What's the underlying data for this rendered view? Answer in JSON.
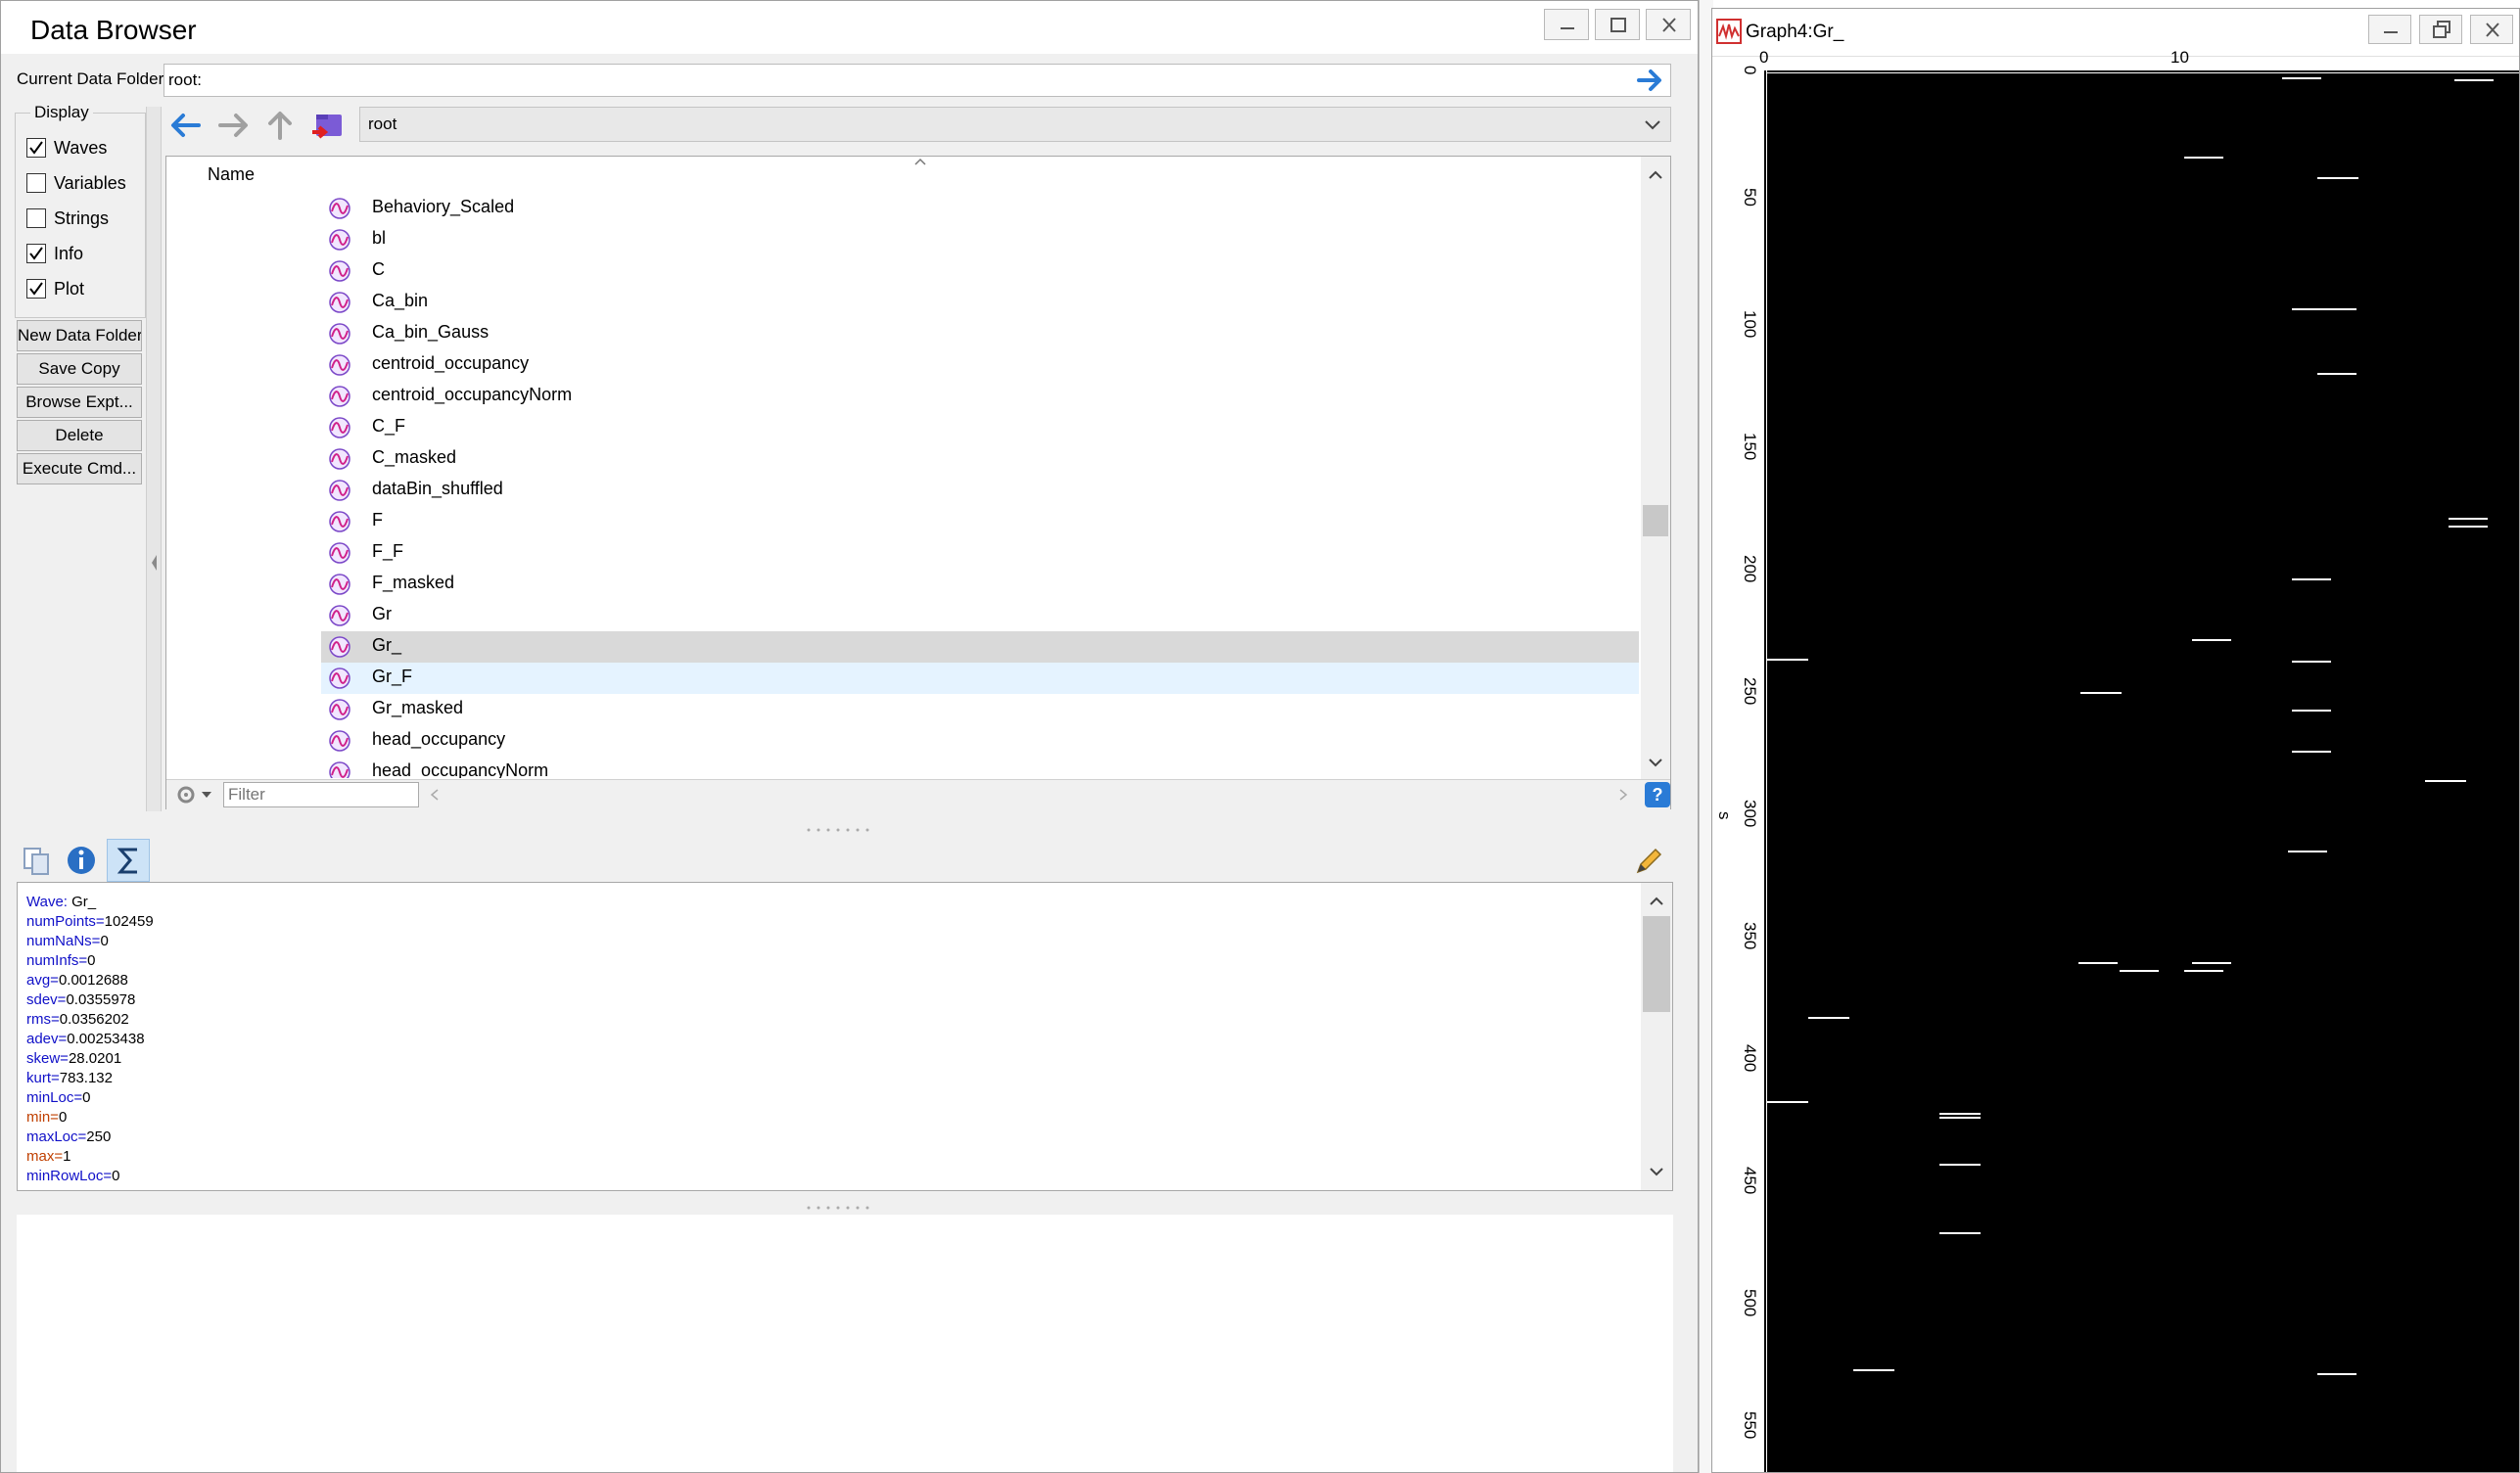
{
  "data_browser": {
    "title": "Data Browser",
    "current_folder_label": "Current Data Folder:",
    "current_folder_value": "root:",
    "folder_dropdown_value": "root",
    "display_group_label": "Display",
    "display_options": [
      {
        "label": "Waves",
        "checked": true
      },
      {
        "label": "Variables",
        "checked": false
      },
      {
        "label": "Strings",
        "checked": false
      },
      {
        "label": "Info",
        "checked": true
      },
      {
        "label": "Plot",
        "checked": true
      }
    ],
    "buttons": [
      "New Data Folder",
      "Save Copy",
      "Browse Expt...",
      "Delete",
      "Execute Cmd..."
    ],
    "list_header": "Name",
    "list_items": [
      {
        "label": "Behaviory_Scaled"
      },
      {
        "label": "bl"
      },
      {
        "label": "C"
      },
      {
        "label": "Ca_bin"
      },
      {
        "label": "Ca_bin_Gauss"
      },
      {
        "label": "centroid_occupancy"
      },
      {
        "label": "centroid_occupancyNorm"
      },
      {
        "label": "C_F"
      },
      {
        "label": "C_masked"
      },
      {
        "label": "dataBin_shuffled"
      },
      {
        "label": "F"
      },
      {
        "label": "F_F"
      },
      {
        "label": "F_masked"
      },
      {
        "label": "Gr"
      },
      {
        "label": "Gr_",
        "state": "selected"
      },
      {
        "label": "Gr_F",
        "state": "hover"
      },
      {
        "label": "Gr_masked"
      },
      {
        "label": "head_occupancy"
      },
      {
        "label": "head_occupancyNorm"
      }
    ],
    "filter_placeholder": "Filter",
    "info_lines": [
      {
        "key": "Wave:",
        "value": " Gr_"
      },
      {
        "key": "numPoints=",
        "value": "102459"
      },
      {
        "key": "numNaNs=",
        "value": "0"
      },
      {
        "key": "numInfs=",
        "value": "0"
      },
      {
        "key": "avg=",
        "value": "0.0012688"
      },
      {
        "key": "sdev=",
        "value": "0.0355978"
      },
      {
        "key": "rms=",
        "value": "0.0356202"
      },
      {
        "key": "adev=",
        "value": "0.00253438"
      },
      {
        "key": "skew=",
        "value": "28.0201"
      },
      {
        "key": "kurt=",
        "value": "783.132"
      },
      {
        "key": "minLoc=",
        "value": "0"
      },
      {
        "key": "min=",
        "value": "0"
      },
      {
        "key": "maxLoc=",
        "value": "250"
      },
      {
        "key": "max=",
        "value": "1"
      },
      {
        "key": "minRowLoc=",
        "value": "0"
      }
    ],
    "colors": {
      "key_blue": "#1010c8",
      "key_orange": "#c04000",
      "selected_row": "#d9d9d9",
      "hover_row": "#e5f3ff",
      "nav_blue": "#2a7bd6"
    }
  },
  "graph": {
    "title": "Graph4:Gr_",
    "x_ticks": [
      "0",
      "10"
    ],
    "y_ticks": [
      "0",
      "50",
      "100",
      "150",
      "200",
      "250",
      "300",
      "350",
      "400",
      "450",
      "500",
      "550"
    ],
    "y_axis_label": "s",
    "image_background": "#000000"
  }
}
